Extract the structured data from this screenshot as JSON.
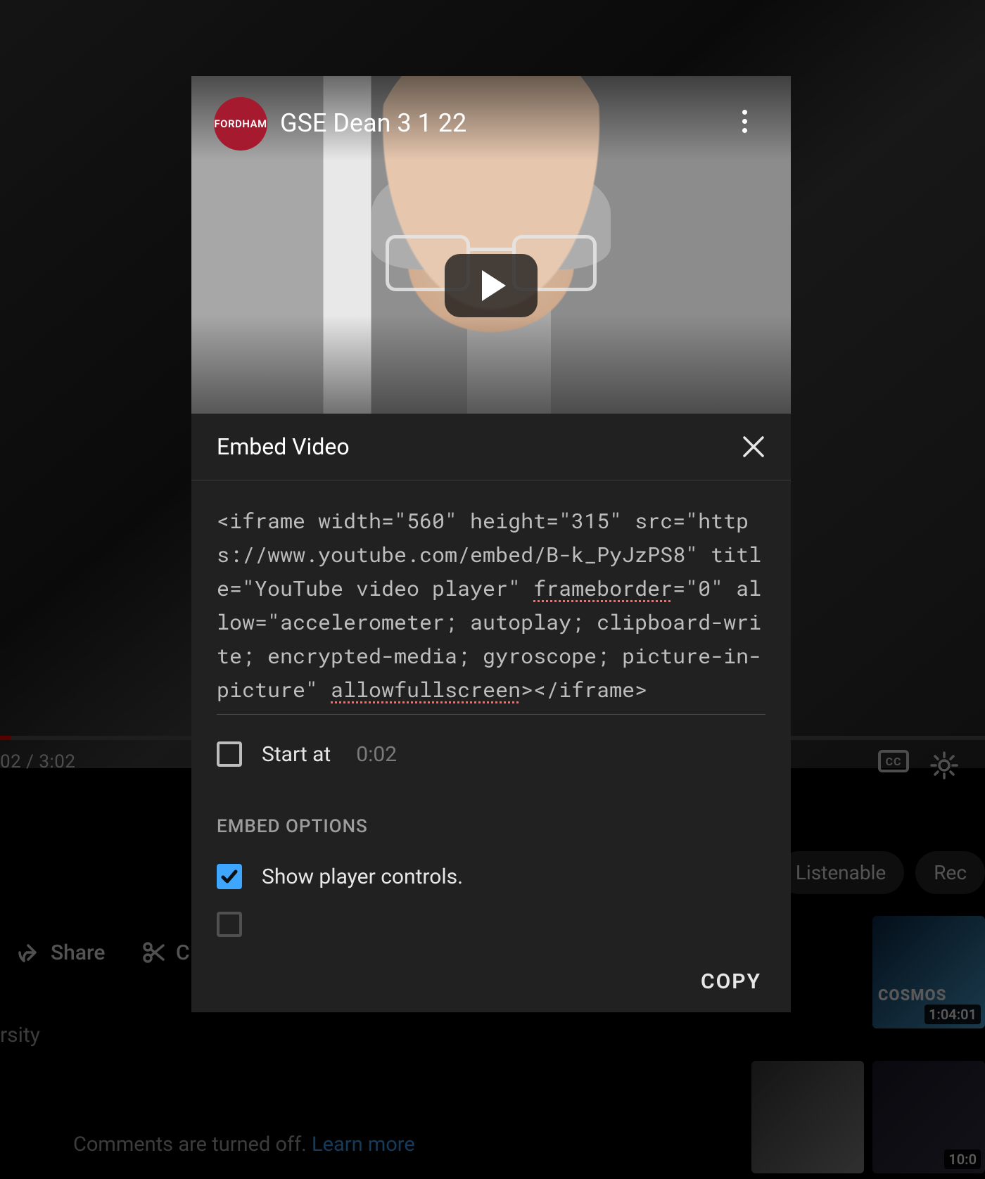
{
  "background": {
    "time_display": "02 / 3:02",
    "share_label": "Share",
    "clip_label": "C",
    "channel_tail": "rsity",
    "comments_off": "Comments are turned off.",
    "learn_more": "Learn more",
    "chips": [
      "Listenable",
      "Rec"
    ],
    "thumb1_duration": "1:04:01",
    "thumb1_title_frag": "COSMOS",
    "thumb2_time_frag": "10:0"
  },
  "video": {
    "channel_avatar_text": "FORDHAM",
    "title": "GSE Dean 3 1 22"
  },
  "dialog": {
    "title": "Embed Video",
    "embed_code_parts": {
      "p1": "<iframe width=\"560\" height=\"315\" src=\"https://www.youtube.com/embed/B-k_PyJzPS8\" title=\"YouTube video player\" ",
      "spell1": "frameborder",
      "p2": "=\"0\" allow=\"accelerometer; autoplay; clipboard-write; encrypted-media; gyroscope; picture-in-picture\" ",
      "spell2": "allowfullscreen",
      "p3": "></iframe>"
    },
    "start_at_label": "Start at",
    "start_at_value": "0:02",
    "start_at_checked": false,
    "options_title": "EMBED OPTIONS",
    "show_controls_label": "Show player controls.",
    "show_controls_checked": true,
    "copy_label": "COPY"
  }
}
